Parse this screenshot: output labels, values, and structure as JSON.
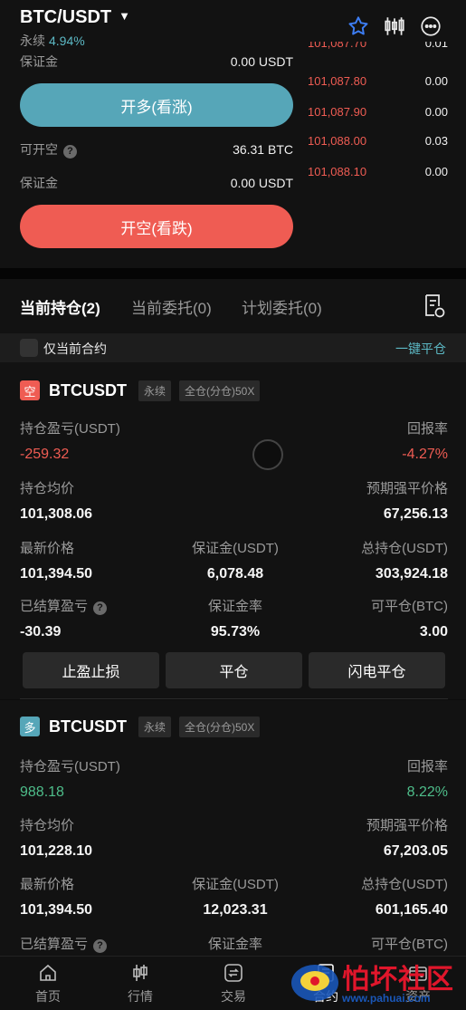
{
  "header": {
    "pair": "BTC/USDT",
    "type": "永续",
    "change": "4.94%"
  },
  "order": {
    "margin_label_1": "保证金",
    "margin_value_1": "0.00 USDT",
    "long_button": "开多(看涨)",
    "open_short_label": "可开空",
    "open_short_value": "36.31 BTC",
    "margin_label_2": "保证金",
    "margin_value_2": "0.00 USDT",
    "short_button": "开空(看跌)"
  },
  "orderbook": [
    {
      "price": "101,087.70",
      "qty": "0.01"
    },
    {
      "price": "101,087.80",
      "qty": "0.00"
    },
    {
      "price": "101,087.90",
      "qty": "0.00"
    },
    {
      "price": "101,088.00",
      "qty": "0.03"
    },
    {
      "price": "101,088.10",
      "qty": "0.00"
    }
  ],
  "tabs": [
    "当前持仓(2)",
    "当前委托(0)",
    "计划委托(0)"
  ],
  "filter": {
    "only_current": "仅当前合约",
    "close_all": "一键平仓"
  },
  "positions": [
    {
      "side": "空",
      "side_color": "#ef5c53",
      "symbol": "BTCUSDT",
      "tag_type": "永续",
      "tag_mode": "全仓(分仓)50X",
      "pnl_label": "持仓盈亏(USDT)",
      "pnl_value": "-259.32",
      "roe_label": "回报率",
      "roe_value": "-4.27%",
      "avg_label": "持仓均价",
      "avg_value": "101,308.06",
      "liq_label": "预期强平价格",
      "liq_value": "67,256.13",
      "last_label": "最新价格",
      "last_value": "101,394.50",
      "margin_label": "保证金(USDT)",
      "margin_value": "6,078.48",
      "total_label": "总持仓(USDT)",
      "total_value": "303,924.18",
      "settled_label": "已结算盈亏",
      "settled_value": "-30.39",
      "ratio_label": "保证金率",
      "ratio_value": "95.73%",
      "closable_label": "可平仓(BTC)",
      "closable_value": "3.00",
      "btn_tpsl": "止盈止损",
      "btn_close": "平仓",
      "btn_flash": "闪电平仓"
    },
    {
      "side": "多",
      "side_color": "#56a6b8",
      "symbol": "BTCUSDT",
      "tag_type": "永续",
      "tag_mode": "全仓(分仓)50X",
      "pnl_label": "持仓盈亏(USDT)",
      "pnl_value": "988.18",
      "roe_label": "回报率",
      "roe_value": "8.22%",
      "avg_label": "持仓均价",
      "avg_value": "101,228.10",
      "liq_label": "预期强平价格",
      "liq_value": "67,203.05",
      "last_label": "最新价格",
      "last_value": "101,394.50",
      "margin_label": "保证金(USDT)",
      "margin_value": "12,023.31",
      "total_label": "总持仓(USDT)",
      "total_value": "601,165.40",
      "settled_label": "已结算盈亏",
      "ratio_label": "保证金率",
      "closable_label": "可平仓(BTC)"
    }
  ],
  "nav": [
    "首页",
    "行情",
    "交易",
    "合约",
    "资产"
  ],
  "watermark": {
    "text": "怕坏社区",
    "url": "www.pahuai.com"
  },
  "colors": {
    "long": "#56a6b8",
    "short": "#ef5c53",
    "profit": "#4ebd8a",
    "accent": "#5cb8c4"
  }
}
